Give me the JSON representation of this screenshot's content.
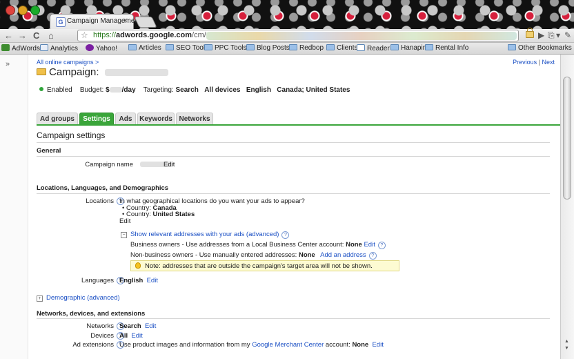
{
  "browser": {
    "tab_title": "Campaign Management",
    "tab_favicon": "G",
    "tab_close": "×",
    "url_scheme": "https://",
    "url_host": "adwords.google.com",
    "url_path": "/cm/",
    "nav": {
      "back": "←",
      "forward": "→",
      "reload": "C",
      "home": "⌂",
      "star": "☆"
    },
    "right_icons": [
      "▶",
      "⎘",
      "▾",
      "✎"
    ]
  },
  "bookmarks": {
    "items": [
      {
        "label": "AdWords",
        "icon": "adwords-icon"
      },
      {
        "label": "Analytics",
        "icon": "analytics-icon"
      },
      {
        "label": "Yahoo!",
        "icon": "yahoo-icon"
      },
      {
        "label": "Articles",
        "icon": "folder-icon"
      },
      {
        "label": "SEO Tools",
        "icon": "folder-icon"
      },
      {
        "label": "PPC Tools",
        "icon": "folder-icon"
      },
      {
        "label": "Blog Posts",
        "icon": "folder-icon"
      },
      {
        "label": "Redbop",
        "icon": "folder-icon"
      },
      {
        "label": "Clients",
        "icon": "folder-icon"
      },
      {
        "label": "Reader",
        "icon": "reader-icon"
      },
      {
        "label": "Hanapin",
        "icon": "folder-icon"
      },
      {
        "label": "Rental Info",
        "icon": "folder-icon"
      }
    ],
    "other": "Other Bookmarks"
  },
  "page": {
    "expand_glyph": "»",
    "breadcrumb": "All online campaigns >",
    "previous": "Previous",
    "separator": "|",
    "next": "Next",
    "title_prefix": "Campaign:",
    "status": {
      "enabled": "Enabled",
      "budget_label": "Budget:",
      "budget_prefix": "$",
      "budget_suffix": "/day",
      "targeting_label": "Targeting:",
      "targeting_values": [
        "Search",
        "All devices",
        "English",
        "Canada; United States"
      ]
    },
    "tabs": [
      {
        "label": "Ad groups",
        "active": false
      },
      {
        "label": "Settings",
        "active": true
      },
      {
        "label": "Ads",
        "active": false
      },
      {
        "label": "Keywords",
        "active": false
      },
      {
        "label": "Networks",
        "active": false
      }
    ],
    "section_title": "Campaign settings",
    "general": {
      "heading": "General",
      "campaign_name_label": "Campaign name",
      "edit": "Edit"
    },
    "locations": {
      "heading": "Locations, Languages, and Demographics",
      "locations_label": "Locations",
      "question": "In what geographical locations do you want your ads to appear?",
      "countries": [
        {
          "prefix": "Country:",
          "name": "Canada"
        },
        {
          "prefix": "Country:",
          "name": "United States"
        }
      ],
      "edit": "Edit",
      "show_addresses": "Show relevant addresses with your ads (advanced)",
      "business_owners": "Business owners - Use addresses from a Local Business Center account:",
      "business_value": "None",
      "business_edit": "Edit",
      "nonbusiness_owners": "Non-business owners - Use manually entered addresses:",
      "nonbusiness_value": "None",
      "add_address": "Add an address",
      "note": "Note: addresses that are outside the campaign's target area will not be shown.",
      "languages_label": "Languages",
      "languages_value": "English",
      "languages_edit": "Edit",
      "demographic": "Demographic (advanced)"
    },
    "networks": {
      "heading": "Networks, devices, and extensions",
      "networks_label": "Networks",
      "networks_value": "Search",
      "networks_edit": "Edit",
      "devices_label": "Devices",
      "devices_value": "All",
      "devices_edit": "Edit",
      "extensions_label": "Ad extensions",
      "extensions_text": "Use product images and information from my",
      "extensions_link": "Google Merchant Center",
      "extensions_account": "account:",
      "extensions_value": "None",
      "extensions_edit": "Edit"
    },
    "help_glyph": "?",
    "plus_glyph": "+",
    "minus_glyph": "−",
    "bullet": "•"
  },
  "colors": {
    "tab_active": "#3aa53a",
    "link": "#1a4fc4",
    "status_enabled": "#2fa53a",
    "note_bg": "#fdfbd2"
  }
}
